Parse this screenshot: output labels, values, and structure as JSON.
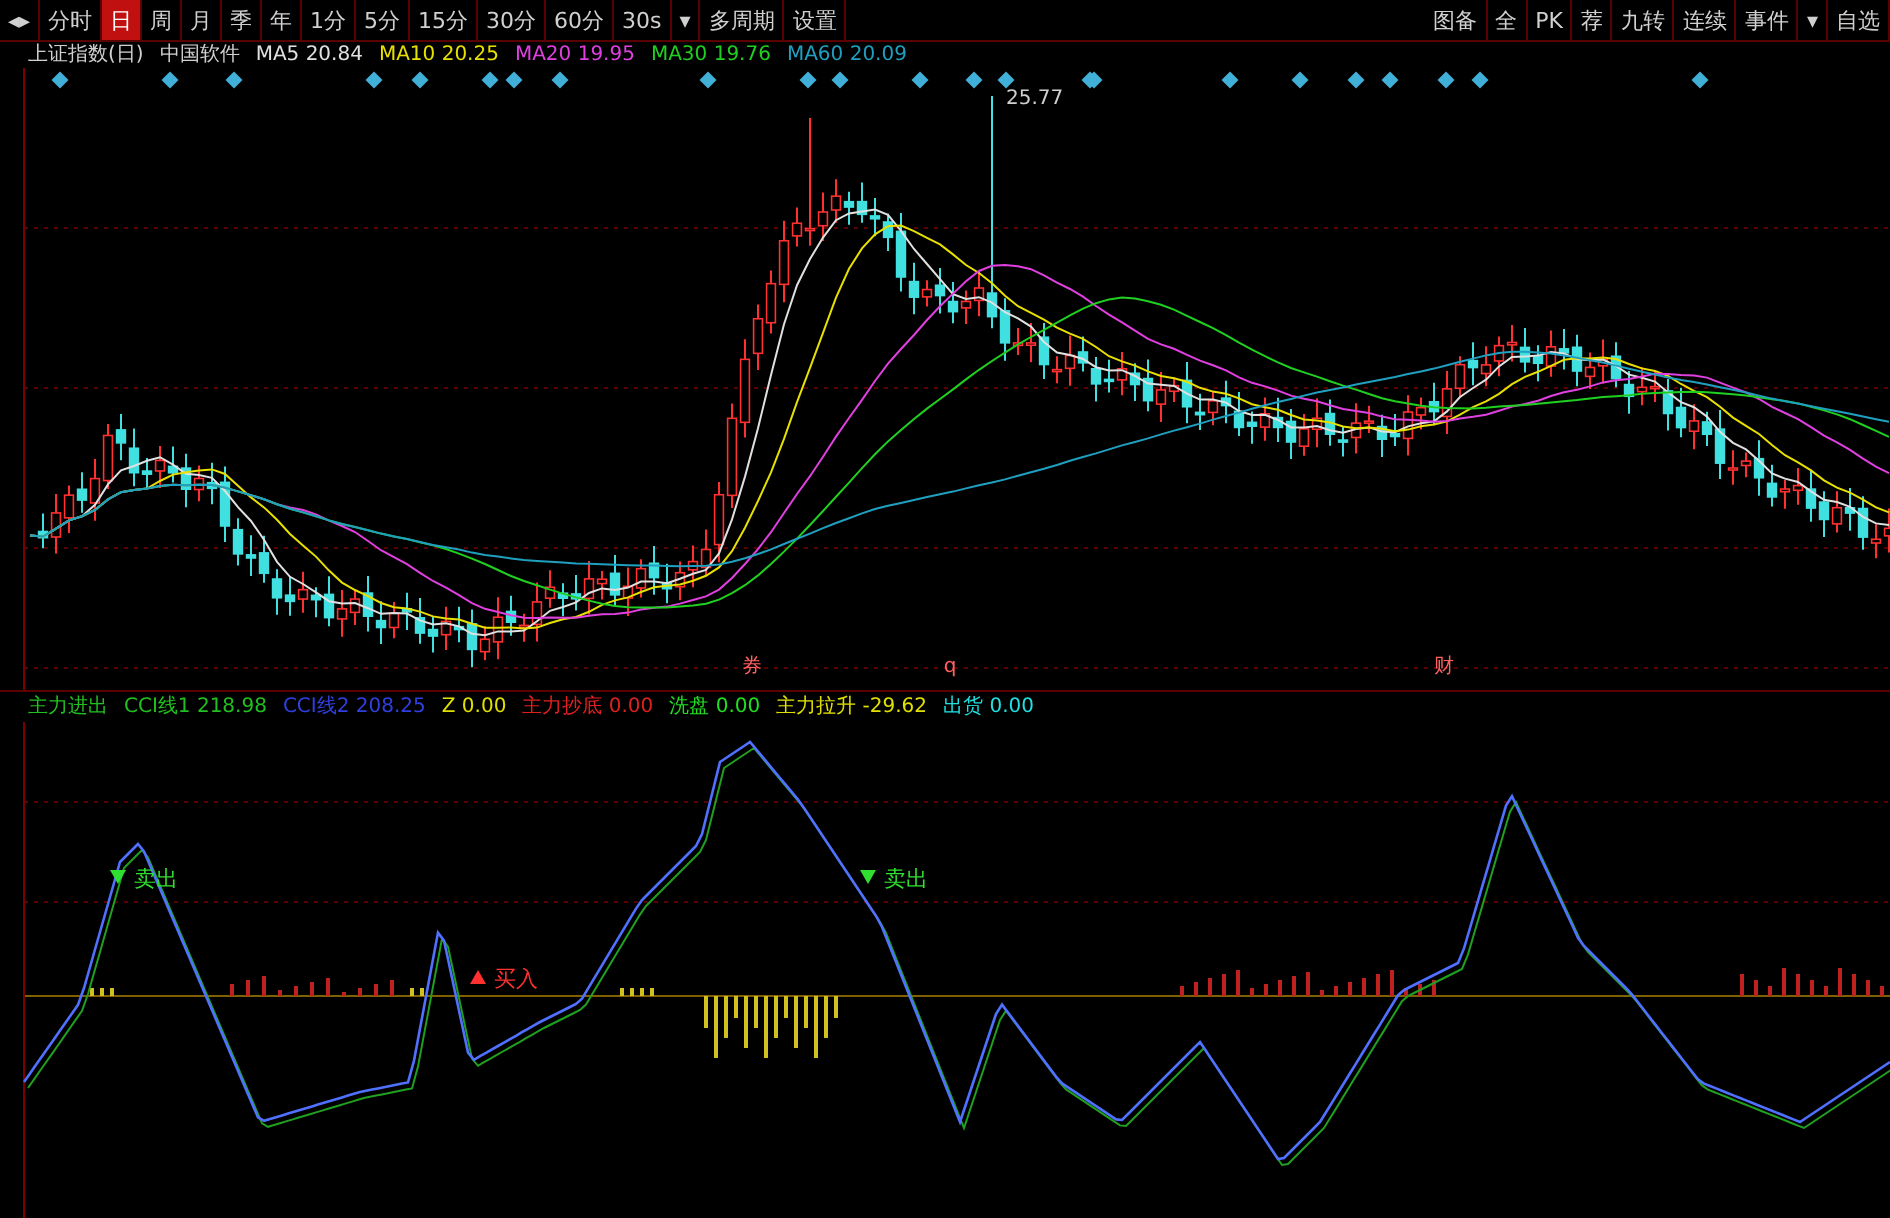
{
  "toolbar": {
    "periods": [
      {
        "label": "◂▸",
        "selected": false
      },
      {
        "label": "分时",
        "selected": false
      },
      {
        "label": "日",
        "selected": true
      },
      {
        "label": "周",
        "selected": false
      },
      {
        "label": "月",
        "selected": false
      },
      {
        "label": "季",
        "selected": false
      },
      {
        "label": "年",
        "selected": false
      },
      {
        "label": "1分",
        "selected": false
      },
      {
        "label": "5分",
        "selected": false
      },
      {
        "label": "15分",
        "selected": false
      },
      {
        "label": "30分",
        "selected": false
      },
      {
        "label": "60分",
        "selected": false
      },
      {
        "label": "30s",
        "selected": false
      },
      {
        "label": "▾",
        "selected": false
      },
      {
        "label": "多周期",
        "selected": false
      },
      {
        "label": "设置",
        "selected": false
      }
    ],
    "tools": [
      "图备",
      "全",
      "PK",
      "荐",
      "九转",
      "连续",
      "事件",
      "▾",
      "自选"
    ]
  },
  "main_legend": [
    {
      "text": "上证指数(日)",
      "color": "#d0d0d0"
    },
    {
      "text": "中国软件",
      "color": "#d0d0d0"
    },
    {
      "text": "MA5 20.84",
      "color": "#e0e0e0"
    },
    {
      "text": "MA10 20.25",
      "color": "#e8e000"
    },
    {
      "text": "MA20 19.95",
      "color": "#e040e0"
    },
    {
      "text": "MA30 19.76",
      "color": "#20d020"
    },
    {
      "text": "MA60 20.09",
      "color": "#20a0c0"
    }
  ],
  "price_label": "25.77",
  "event_marks": [
    "券",
    "q",
    "财"
  ],
  "indicator_legend": [
    {
      "text": "主力进出",
      "color": "#20c020"
    },
    {
      "text": "CCI线1 218.98",
      "color": "#20c020"
    },
    {
      "text": "CCI线2 208.25",
      "color": "#3040e0"
    },
    {
      "text": "Z 0.00",
      "color": "#e0e000"
    },
    {
      "text": "主力抄底 0.00",
      "color": "#e02020"
    },
    {
      "text": "洗盘 0.00",
      "color": "#20e020"
    },
    {
      "text": "主力拉升 -29.62",
      "color": "#e0e000"
    },
    {
      "text": "出货 0.00",
      "color": "#20e0e0"
    }
  ],
  "signals": [
    {
      "kind": "sell",
      "text": "卖出"
    },
    {
      "kind": "sell",
      "text": "卖出"
    },
    {
      "kind": "buy",
      "text": "买入"
    }
  ]
}
